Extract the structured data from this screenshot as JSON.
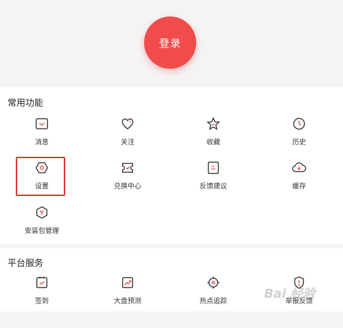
{
  "header": {
    "login_label": "登录"
  },
  "common": {
    "title": "常用功能",
    "items": [
      {
        "label": "消息",
        "icon": "message-icon"
      },
      {
        "label": "关注",
        "icon": "heart-icon"
      },
      {
        "label": "收藏",
        "icon": "star-icon"
      },
      {
        "label": "历史",
        "icon": "clock-icon"
      },
      {
        "label": "设置",
        "icon": "settings-hexagon-icon"
      },
      {
        "label": "兑换中心",
        "icon": "exchange-icon"
      },
      {
        "label": "反馈建议",
        "icon": "feedback-icon"
      },
      {
        "label": "缓存",
        "icon": "cloud-download-icon"
      },
      {
        "label": "安装包管理",
        "icon": "package-icon"
      }
    ]
  },
  "platform": {
    "title": "平台服务",
    "items": [
      {
        "label": "签到",
        "icon": "checkin-icon"
      },
      {
        "label": "大盘预测",
        "icon": "trend-chart-icon"
      },
      {
        "label": "热点追踪",
        "icon": "target-icon"
      },
      {
        "label": "举报反馈",
        "icon": "shield-alert-icon"
      }
    ]
  },
  "watermark": "Bai 经验",
  "colors": {
    "accent": "#f24b4b",
    "highlight_border": "#e03030",
    "icon_stroke": "#333333"
  }
}
